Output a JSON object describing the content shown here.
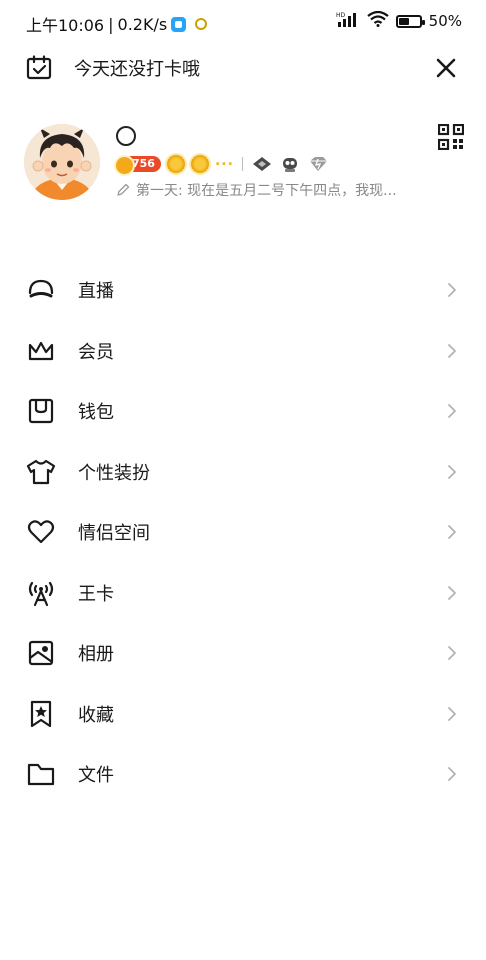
{
  "status_bar": {
    "time": "上午10:06",
    "network_speed": "0.2K/s",
    "separator": "|",
    "signal_label": "HD",
    "battery": "50%"
  },
  "header": {
    "checkin_text": "今天还没打卡哦",
    "checkin_icon": "calendar-check-icon",
    "close_icon": "close-icon"
  },
  "profile": {
    "level": "756",
    "more_badges": "...",
    "signature": "第一天: 现在是五月二号下午四点，我现...",
    "qr_icon": "qr-code-icon"
  },
  "menu": {
    "items": [
      {
        "label": "直播",
        "icon": "live-icon"
      },
      {
        "label": "会员",
        "icon": "crown-icon"
      },
      {
        "label": "钱包",
        "icon": "wallet-icon"
      },
      {
        "label": "个性装扮",
        "icon": "tshirt-icon"
      },
      {
        "label": "情侣空间",
        "icon": "heart-icon"
      },
      {
        "label": "王卡",
        "icon": "signal-tower-icon"
      },
      {
        "label": "相册",
        "icon": "album-icon"
      },
      {
        "label": "收藏",
        "icon": "bookmark-star-icon"
      },
      {
        "label": "文件",
        "icon": "folder-icon"
      }
    ]
  },
  "colors": {
    "text": "#1a1a1a",
    "secondary_text": "#888888",
    "chevron": "#b3b3b3",
    "level_badge": "#e94a2a"
  }
}
